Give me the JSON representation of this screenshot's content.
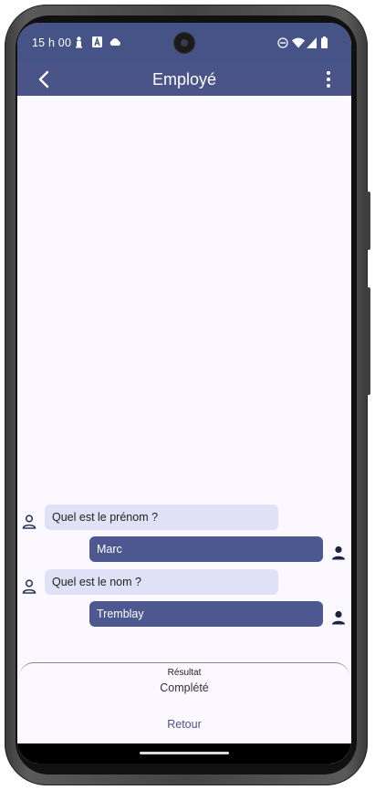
{
  "status": {
    "time": "15 h 00",
    "left_icons": [
      "person-icon",
      "app-a-icon",
      "cloud-icon"
    ],
    "right_icons": [
      "dnd-icon",
      "wifi-icon",
      "signal-icon",
      "battery-icon"
    ]
  },
  "appbar": {
    "title": "Employé"
  },
  "chat": {
    "messages": [
      {
        "from": "bot",
        "text": "Quel est le prénom ?"
      },
      {
        "from": "user",
        "text": "Marc"
      },
      {
        "from": "bot",
        "text": "Quel est le nom ?"
      },
      {
        "from": "user",
        "text": "Tremblay"
      }
    ]
  },
  "result": {
    "label": "Résultat",
    "value": "Complété",
    "return_label": "Retour"
  },
  "colors": {
    "primary": "#4a5489",
    "bot_bubble": "#e0e0f6",
    "user_bubble": "#4d5890",
    "background": "#fbf8ff"
  }
}
